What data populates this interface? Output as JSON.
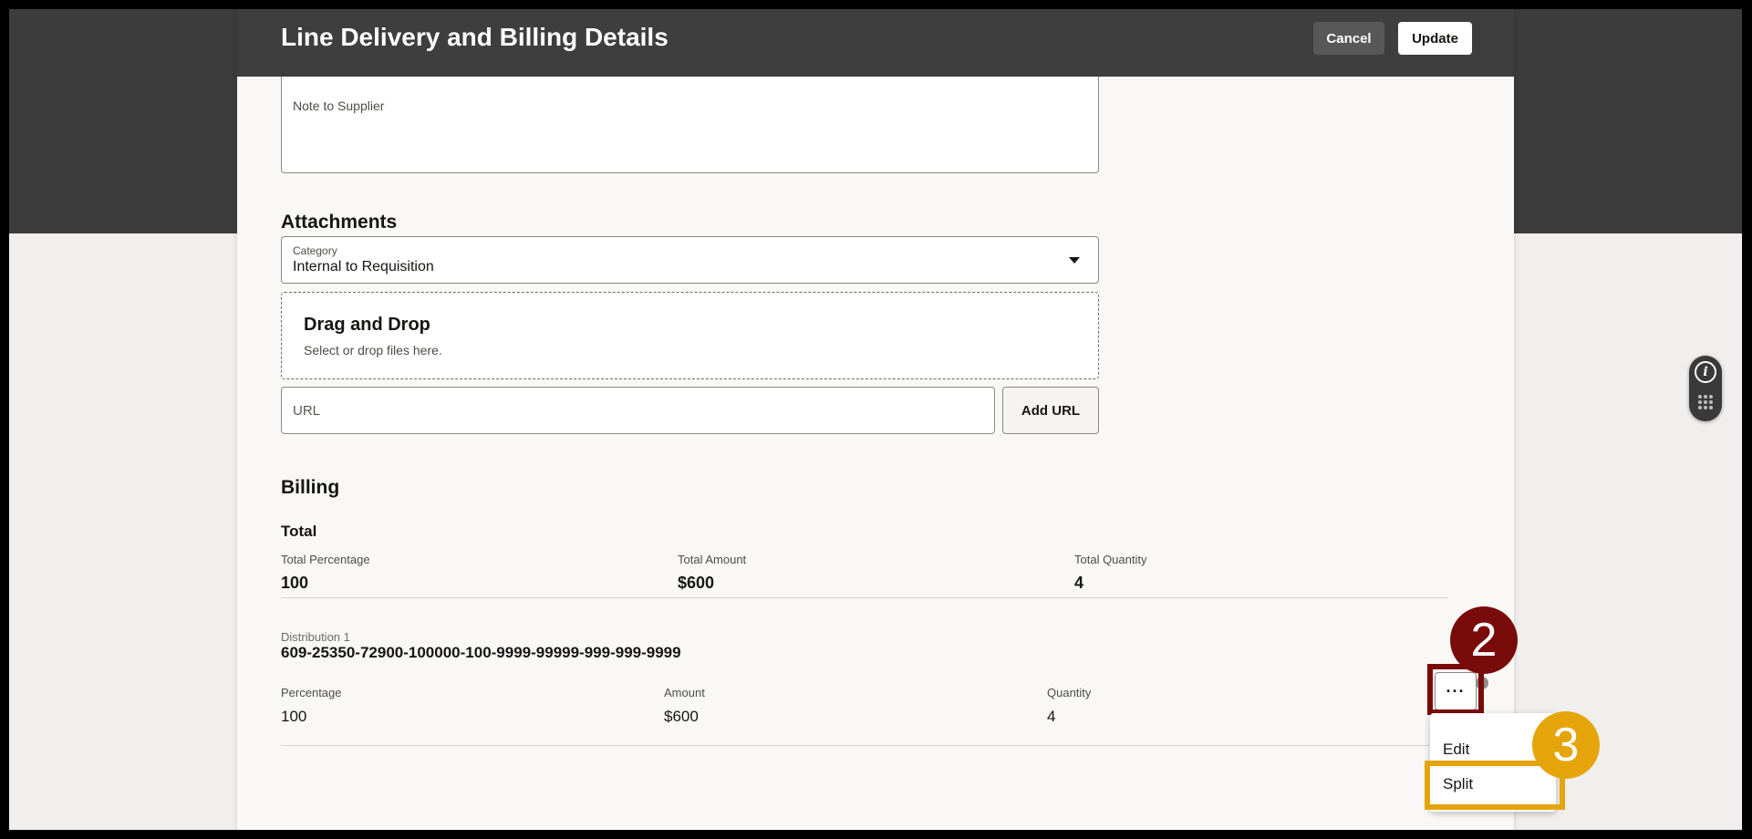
{
  "header": {
    "title": "Line Delivery and Billing Details",
    "cancel_label": "Cancel",
    "update_label": "Update"
  },
  "note_to_supplier": {
    "label": "Note to Supplier",
    "value": ""
  },
  "attachments": {
    "title": "Attachments",
    "category_label": "Category",
    "category_value": "Internal to Requisition",
    "drop_title": "Drag and Drop",
    "drop_subtitle": "Select or drop files here.",
    "url_placeholder": "URL",
    "add_url_label": "Add URL"
  },
  "billing": {
    "title": "Billing",
    "total": {
      "title": "Total",
      "percentage_label": "Total Percentage",
      "percentage_value": "100",
      "amount_label": "Total Amount",
      "amount_value": "$600",
      "quantity_label": "Total Quantity",
      "quantity_value": "4"
    },
    "distribution": {
      "label": "Distribution 1",
      "account": "609-25350-72900-100000-100-9999-99999-999-999-9999",
      "percentage_label": "Percentage",
      "percentage_value": "100",
      "amount_label": "Amount",
      "amount_value": "$600",
      "quantity_label": "Quantity",
      "quantity_value": "4"
    }
  },
  "actions_menu": {
    "more_label": "···",
    "items": [
      {
        "label": "Edit"
      },
      {
        "label": "Split"
      }
    ]
  },
  "annotations": {
    "step_2": "2",
    "step_3": "3",
    "step_2_color": "#7a0b0b",
    "step_3_color": "#e5a50a"
  },
  "icons": {
    "info": "info-icon",
    "info_glyph": "i",
    "grip": "grip-dots-icon",
    "caret": "chevron-down-icon"
  }
}
